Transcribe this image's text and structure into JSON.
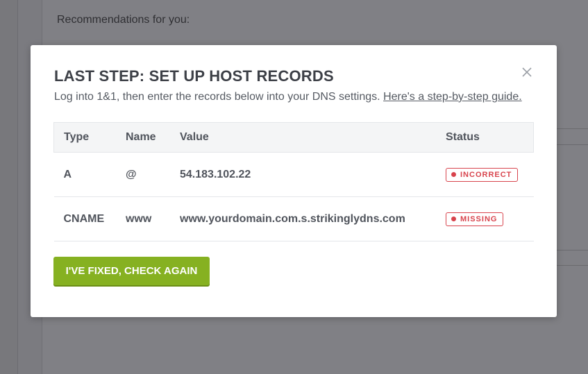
{
  "background": {
    "recommendations_label": "Recommendations for you:"
  },
  "modal": {
    "title": "LAST STEP: SET UP HOST RECORDS",
    "subtitle": "Log into 1&1, then enter the records below into your DNS settings.",
    "guide_link": "Here's a step-by-step guide.",
    "close_icon": "close-icon",
    "table": {
      "headers": [
        "Type",
        "Name",
        "Value",
        "Status"
      ],
      "rows": [
        {
          "type": "A",
          "name": "@",
          "value": "54.183.102.22",
          "status": "INCORRECT"
        },
        {
          "type": "CNAME",
          "name": "www",
          "value": "www.yourdomain.com.s.strikinglydns.com",
          "status": "MISSING"
        }
      ]
    },
    "check_button": "I'VE FIXED, CHECK AGAIN"
  },
  "colors": {
    "accent_green": "#86b121",
    "status_red": "#d8434c",
    "text_dark": "#3d4047"
  }
}
